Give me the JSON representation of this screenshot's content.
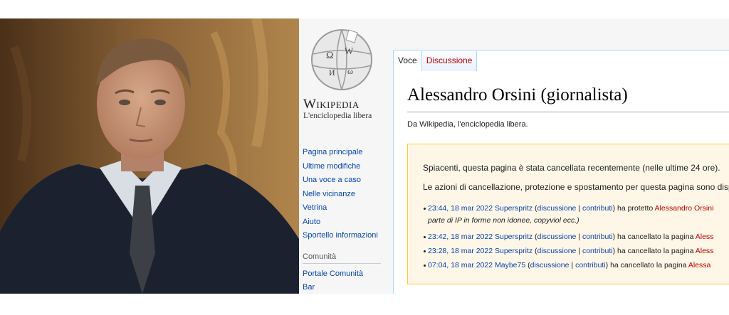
{
  "colors": {
    "link": "#0645ad",
    "redlink": "#ba0000",
    "notice_bg": "#fef6e7",
    "notice_border": "#ffcc33",
    "sidebar_bg": "#f6f6f6"
  },
  "photo": {
    "icon": "person-photo"
  },
  "logo": {
    "icon": "wikipedia-puzzle-globe-icon",
    "wordmark": "Wikipedia",
    "tagline": "L'enciclopedia libera"
  },
  "nav": {
    "items": [
      "Pagina principale",
      "Ultime modifiche",
      "Una voce a caso",
      "Nelle vicinanze",
      "Vetrina",
      "Aiuto",
      "Sportello informazioni"
    ],
    "community_heading": "Comunità",
    "community_items": [
      "Portale Comunità",
      "Bar"
    ]
  },
  "tabs": {
    "voce": "Voce",
    "discussione": "Discussione"
  },
  "page": {
    "title": "Alessandro Orsini (giornalista)",
    "from": "Da Wikipedia, l'enciclopedia libera."
  },
  "notice": {
    "line1": "Spiacenti, questa pagina è stata cancellata recentemente (nelle ultime 24 ore).",
    "line2": "Le azioni di cancellazione, protezione e spostamento per questa pagina sono disp",
    "log": [
      {
        "time": "23:44, 18 mar 2022",
        "user": "Superspritz",
        "talk": "discussione",
        "sep": " | ",
        "contrib": "contributi",
        "action": ") ha protetto ",
        "target": "Alessandro Orsini",
        "sub": "parte di IP in forme non idonee, copyviol ecc.)"
      },
      {
        "time": "23:42, 18 mar 2022",
        "user": "Superspritz",
        "talk": "discussione",
        "sep": " | ",
        "contrib": "contributi",
        "action": ") ha cancellato la pagina ",
        "target": "Aless"
      },
      {
        "time": "23:28, 18 mar 2022",
        "user": "Superspritz",
        "talk": "discussione",
        "sep": " | ",
        "contrib": "contributi",
        "action": ") ha cancellato la pagina ",
        "target": "Aless"
      },
      {
        "time": "07:04, 18 mar 2022",
        "user": "Maybe75",
        "talk": "discussione",
        "sep": " | ",
        "contrib": "contributi",
        "action": ") ha cancellato la pagina ",
        "target": "Alessa"
      }
    ]
  }
}
